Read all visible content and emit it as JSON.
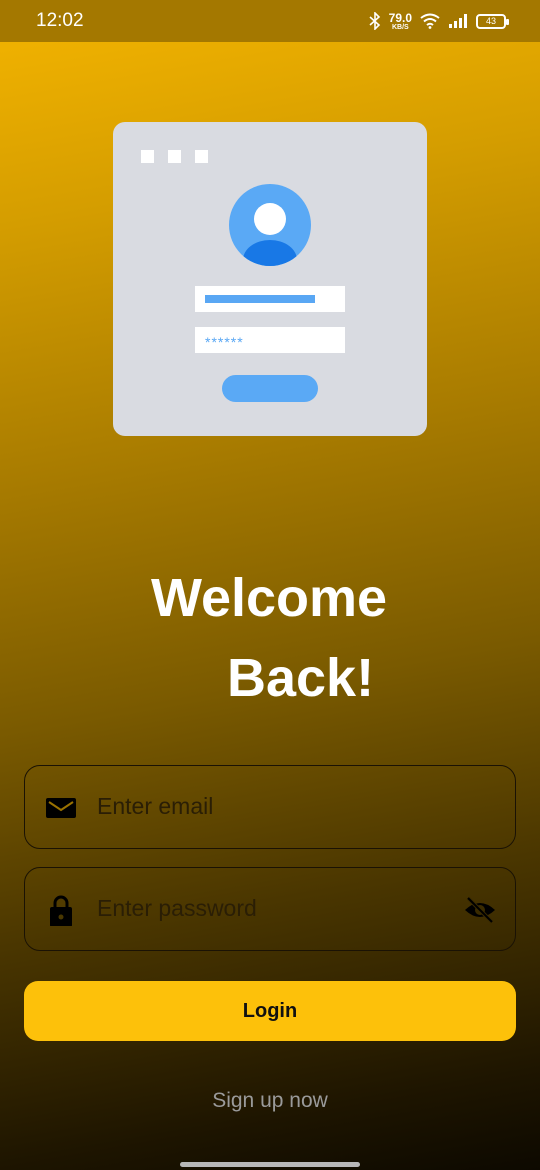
{
  "status_bar": {
    "time": "12:02",
    "net_speed_value": "79.0",
    "net_speed_unit": "KB/S",
    "battery": "43"
  },
  "illustration": {
    "password_mask": "******"
  },
  "welcome": {
    "line1": "Welcome",
    "line2": "Back!"
  },
  "form": {
    "email_placeholder": "Enter email",
    "password_placeholder": "Enter password",
    "login_label": "Login",
    "signup_label": "Sign up now"
  },
  "colors": {
    "accent": "#fdc10a",
    "illustration_blue": "#5aa9f5"
  }
}
